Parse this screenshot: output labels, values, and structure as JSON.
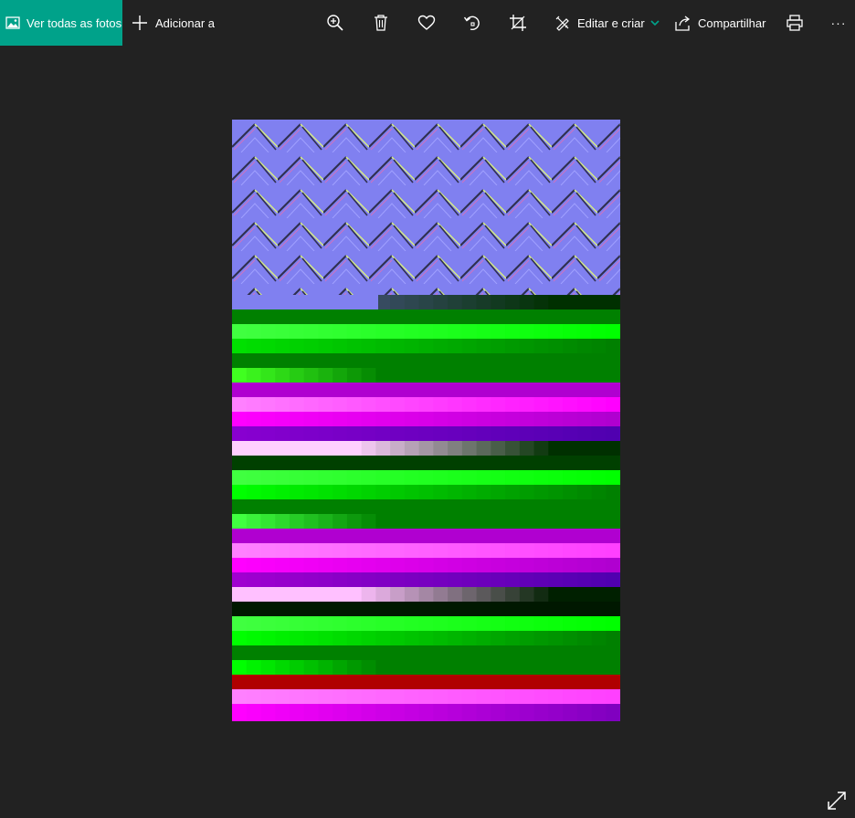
{
  "toolbar": {
    "all_photos_label": "Ver todas as fotos",
    "add_label": "Adicionar a",
    "edit_label": "Editar e criar",
    "share_label": "Compartilhar",
    "more_label": "···",
    "accent_color": "#00a28a",
    "icons": [
      "photos-icon",
      "plus-icon",
      "zoom-icon",
      "delete-icon",
      "favorite-icon",
      "rotate-icon",
      "crop-icon",
      "edit-create-icon",
      "chevron-down-icon",
      "share-icon",
      "print-icon",
      "more-icon"
    ]
  },
  "viewer": {
    "background_color": "#222222",
    "image_palette": {
      "normal_map": "#7f7ff0",
      "green": "#008000",
      "bright_green": "#00ff00",
      "magenta": "#ff00ff",
      "pink": "#ff80ff",
      "purple": "#8000c0",
      "red": "#b00000"
    }
  }
}
